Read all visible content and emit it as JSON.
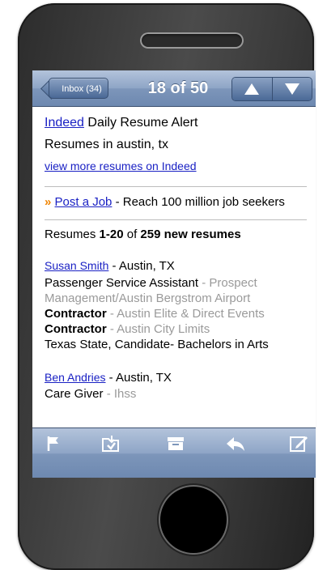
{
  "nav": {
    "back_label": "Inbox (34)",
    "title": "18 of 50",
    "prev_icon": "arrow-up-icon",
    "next_icon": "arrow-down-icon"
  },
  "email": {
    "header_link": "Indeed",
    "header_rest": " Daily Resume Alert",
    "subtitle": "Resumes in austin, tx",
    "view_more": "view more resumes on Indeed",
    "promo_marker": "»",
    "promo_link": "Post a Job",
    "promo_rest": " - Reach 100 million job seekers",
    "summary_prefix": "Resumes ",
    "summary_range": "1-20",
    "summary_mid": " of ",
    "summary_count": "259 new resumes",
    "candidates": [
      {
        "name": "Susan Smith",
        "location": " - Austin, TX",
        "line1_title": "Passenger Service Assistant",
        "line1_org": " - Prospect",
        "line2": "Management/Austin Bergstrom Airport",
        "line3_title": "Contractor",
        "line3_org": " - Austin Elite & Direct Events",
        "line4_title": "Contractor",
        "line4_org": " - Austin City Limits",
        "line5": "Texas State, Candidate- Bachelors in Arts"
      },
      {
        "name": "Ben Andries",
        "location": "  - Austin, TX",
        "line1_title": "Care Giver",
        "line1_org": " - Ihss"
      }
    ]
  },
  "toolbar": {
    "icons": [
      "flag-icon",
      "move-folder-icon",
      "archive-icon",
      "reply-icon",
      "compose-icon"
    ]
  },
  "colors": {
    "nav_blue": "#7d96ba",
    "link": "#1a21c4",
    "accent_orange": "#f08400",
    "muted_text": "#9a9a9a"
  }
}
